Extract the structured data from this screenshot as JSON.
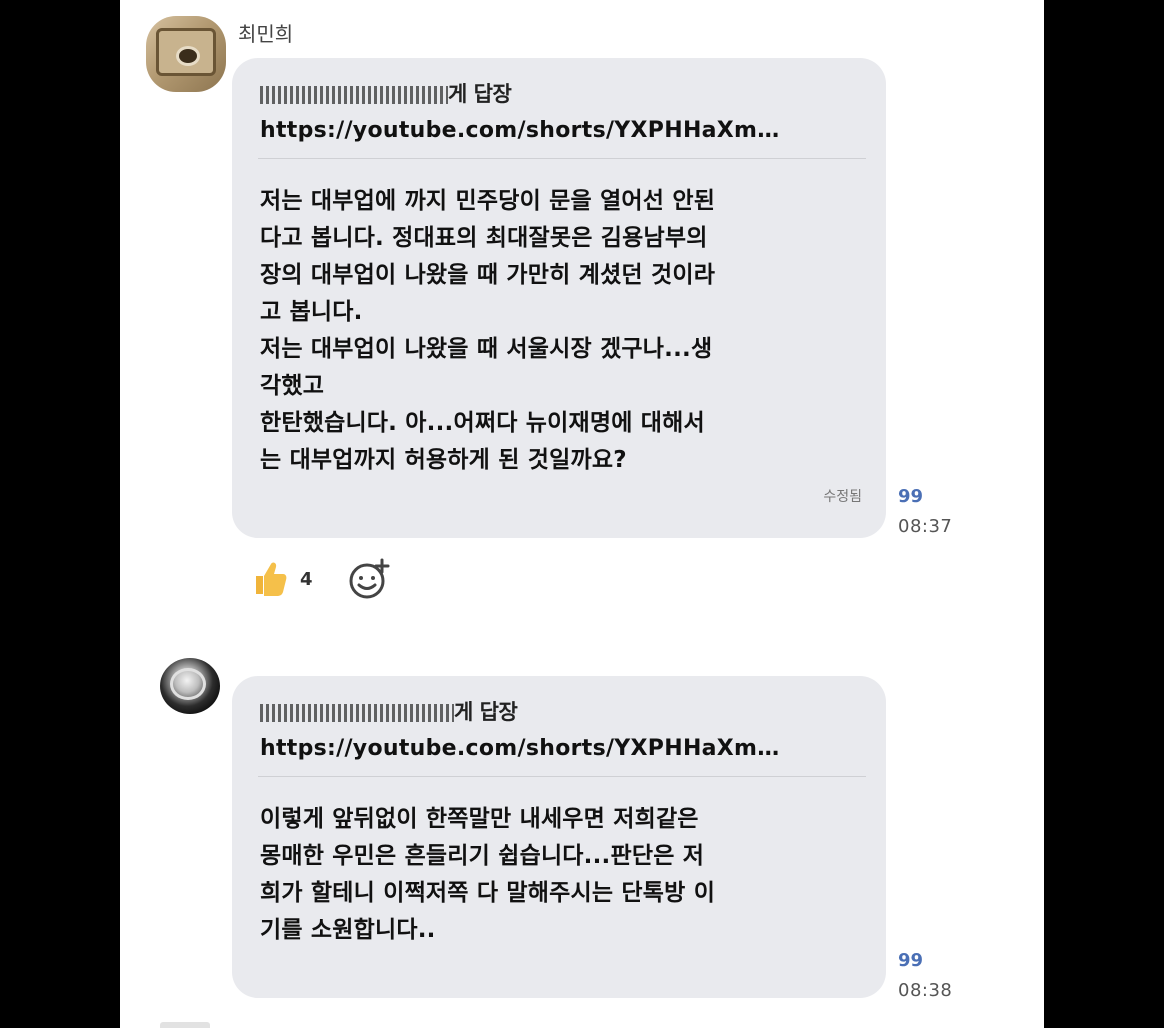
{
  "messages": [
    {
      "sender": "최민희",
      "reply_to_label": "게 답장",
      "link": "https://youtube.com/shorts/YXPHHaXm…",
      "text": "저는 대부업에 까지 민주당이 문을 열어선 안된\n다고 봅니다. 정대표의 최대잘못은 김용남부의\n장의 대부업이 나왔을 때 가만히 계셨던 것이라\n고 봅니다.\n저는 대부업이 나왔을 때 서울시장 겠구나...생\n각했고\n한탄했습니다. 아...어쩌다 뉴이재명에 대해서\n는 대부업까지 허용하게 된 것일까요?",
      "edited_label": "수정됨",
      "read_count": "99",
      "time": "08:37",
      "reaction_count": "4"
    },
    {
      "sender": "",
      "reply_to_label": "게 답장",
      "link": "https://youtube.com/shorts/YXPHHaXm…",
      "text": "이렇게 앞뒤없이 한쪽말만 내세우면 저희같은\n몽매한 우민은 흔들리기 쉽습니다...판단은 저\n희가 할테니 이쩍저쪽 다 말해주시는 단톡방 이\n기를 소원합니다..",
      "read_count": "99",
      "time": "08:38"
    }
  ],
  "colors": {
    "bubble": "#e9eaee",
    "read_count": "#4a6fb5",
    "background": "#ffffff",
    "frame": "#000000"
  },
  "icons": [
    "thumbs-up-icon",
    "add-reaction-icon"
  ]
}
